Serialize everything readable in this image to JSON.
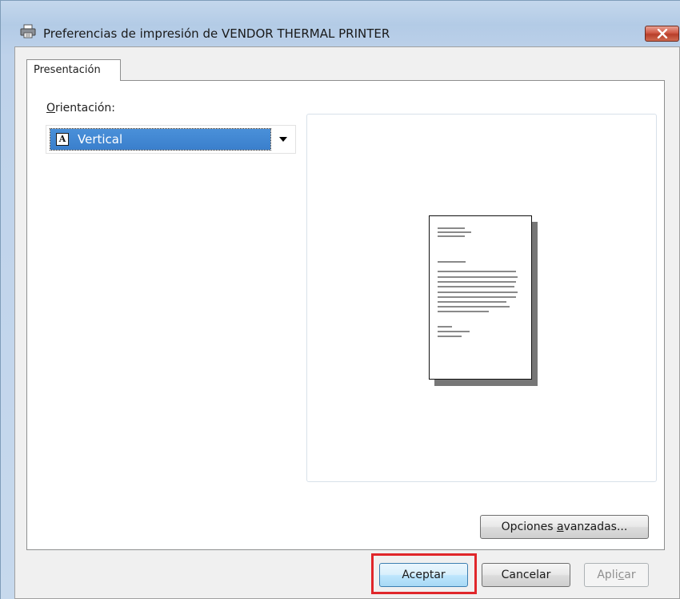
{
  "window": {
    "title": "Preferencias de impresión de VENDOR THERMAL PRINTER",
    "icon": "printer-icon",
    "close_icon": "close-icon"
  },
  "tabs": [
    {
      "label": "Presentación",
      "selected": true
    }
  ],
  "orientation": {
    "label_underlined": "O",
    "label_rest": "rientación:",
    "selected_value": "Vertical",
    "icon": "portrait-page-icon",
    "icon_letter": "A"
  },
  "preview": {
    "icon": "document-preview-icon"
  },
  "buttons": {
    "advanced_pre": "Opciones ",
    "advanced_underlined": "a",
    "advanced_post": "vanzadas...",
    "accept": "Aceptar",
    "cancel": "Cancelar",
    "apply_pre": "Apli",
    "apply_underlined": "c",
    "apply_post": "ar",
    "apply_enabled": false
  },
  "colors": {
    "selection": "#3a7fcc",
    "highlight_box": "#e0262a",
    "close_button": "#c9503c"
  }
}
